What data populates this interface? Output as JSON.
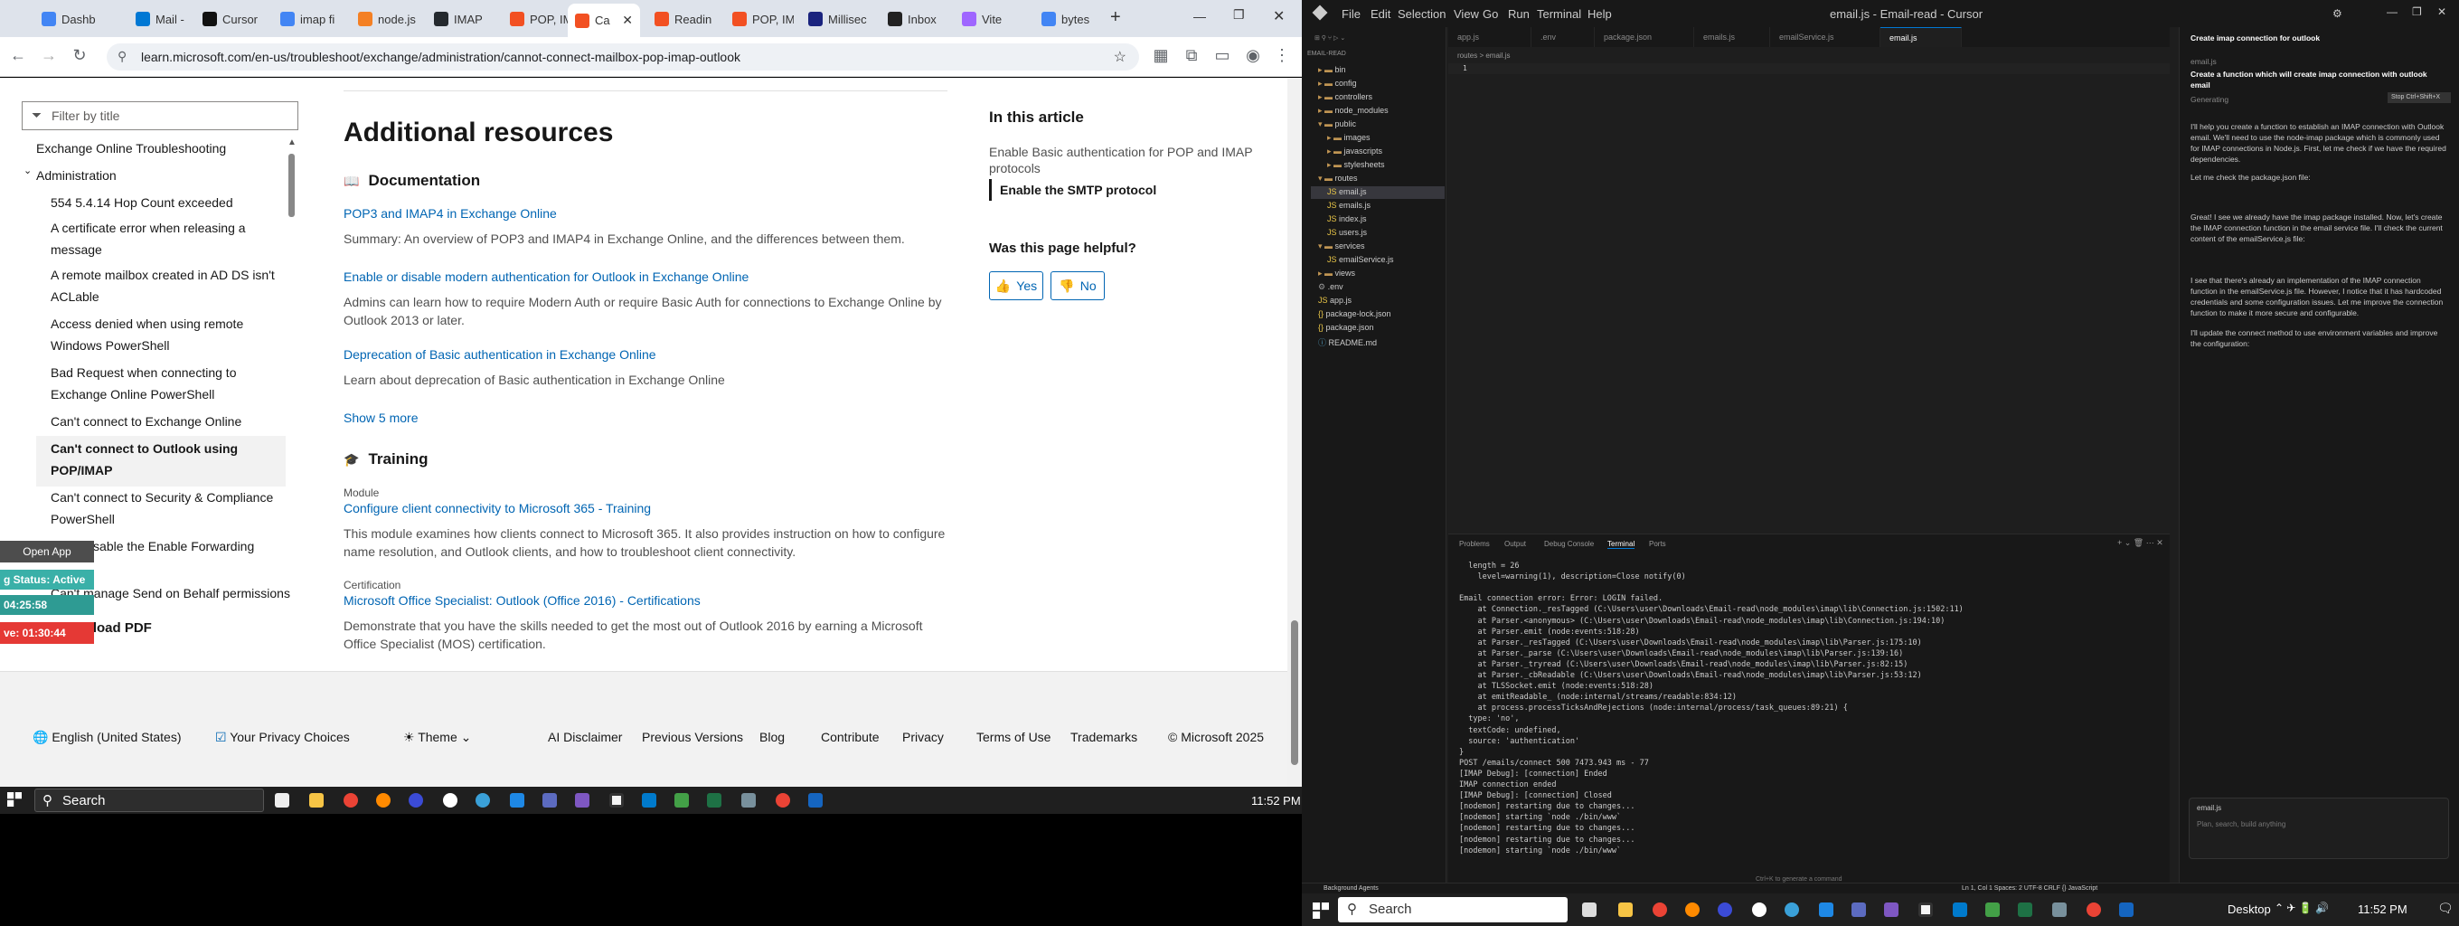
{
  "browser": {
    "tabs": [
      {
        "label": "Dashb",
        "color": "#4285f4"
      },
      {
        "label": "Mail -",
        "color": "#0078d4"
      },
      {
        "label": "Cursor",
        "color": "#111111"
      },
      {
        "label": "imap fi",
        "color": "#4285f4"
      },
      {
        "label": "node.js",
        "color": "#f48024"
      },
      {
        "label": "IMAP",
        "color": "#24292e"
      },
      {
        "label": "POP, IM",
        "color": "#f25022"
      },
      {
        "label": "Ca",
        "color": "#f25022"
      },
      {
        "label": "Readin",
        "color": "#f25022"
      },
      {
        "label": "POP, IM",
        "color": "#f25022"
      },
      {
        "label": "Millisec",
        "color": "#1a237e"
      },
      {
        "label": "Inbox",
        "color": "#222222"
      },
      {
        "label": "Vite",
        "color": "#9f66ff"
      },
      {
        "label": "bytes",
        "color": "#4285f4"
      }
    ],
    "url": "learn.microsoft.com/en-us/troubleshoot/exchange/administration/cannot-connect-mailbox-pop-imap-outlook"
  },
  "sidebar": {
    "filter_placeholder": "Filter by title",
    "items": [
      "Exchange Online Troubleshooting",
      "Administration",
      "554 5.4.14 Hop Count exceeded",
      "A certificate error when releasing a",
      "message",
      "A remote mailbox created in AD DS isn't",
      "ACLable",
      "Access denied when using remote",
      "Windows PowerShell",
      "Bad Request when connecting to",
      "Exchange Online PowerShell",
      "Can't connect to Exchange Online",
      "Can't connect to Outlook using",
      "POP/IMAP",
      "Can't connect to Security & Compliance",
      "PowerShell",
      "Can't disable the Enable Forwarding",
      "Can't manage Send on Behalf permissions"
    ],
    "download_pdf": "Download PDF"
  },
  "overlay": {
    "open_app": "Open App",
    "status": "g Status: Active",
    "time1": "04:25:58",
    "time2": "ve: 01:30:44"
  },
  "main": {
    "heading": "Additional resources",
    "documentation_heading": "Documentation",
    "docs": [
      {
        "title": "POP3 and IMAP4 in Exchange Online",
        "desc": "Summary: An overview of POP3 and IMAP4 in Exchange Online, and the differences between them."
      },
      {
        "title": "Enable or disable modern authentication for Outlook in Exchange Online",
        "desc": "Admins can learn how to require Modern Auth or require Basic Auth for connections to Exchange Online by Outlook 2013 or later."
      },
      {
        "title": "Deprecation of Basic authentication in Exchange Online",
        "desc": "Learn about deprecation of Basic authentication in Exchange Online"
      }
    ],
    "show_more": "Show 5 more",
    "training_heading": "Training",
    "module_label": "Module",
    "module_title": "Configure client connectivity to Microsoft 365 - Training",
    "module_desc": "This module examines how clients connect to Microsoft 365. It also provides instruction on how to configure name resolution, and Outlook clients, and how to troubleshoot client connectivity.",
    "cert_label": "Certification",
    "cert_title": "Microsoft Office Specialist: Outlook (Office 2016) - Certifications",
    "cert_desc": "Demonstrate that you have the skills needed to get the most out of Outlook 2016 by earning a Microsoft Office Specialist (MOS) certification."
  },
  "article_nav": {
    "heading": "In this article",
    "items": [
      "Enable Basic authentication for POP and IMAP",
      "protocols",
      "Enable the SMTP protocol"
    ],
    "helpful": "Was this page helpful?",
    "yes": "Yes",
    "no": "No"
  },
  "footer": {
    "locale": "English (United States)",
    "privacy": "Your Privacy Choices",
    "theme": "Theme",
    "links": [
      "AI Disclaimer",
      "Previous Versions",
      "Blog",
      "Contribute",
      "Privacy",
      "Terms of Use",
      "Trademarks",
      "© Microsoft 2025"
    ]
  },
  "taskbar_left": {
    "search": "Search",
    "time": "11:52 PM"
  },
  "editor": {
    "menu": [
      "File",
      "Edit",
      "Selection",
      "View",
      "Go",
      "Run",
      "Terminal",
      "Help"
    ],
    "title": "email.js - Email-read - Cursor",
    "explorer_title": "EMAIL-READ",
    "files": [
      "bin",
      "config",
      "controllers",
      "node_modules",
      "public",
      "images",
      "javascripts",
      "stylesheets",
      "routes",
      "email.js",
      "emails.js",
      "index.js",
      "users.js",
      "services",
      "emailService.js",
      "views",
      ".env",
      "app.js",
      "package-lock.json",
      "package.json",
      "README.md"
    ],
    "tabs": [
      "app.js",
      ".env",
      "package.json",
      "emails.js",
      "emailService.js",
      "email.js"
    ],
    "breadcrumb": "routes > email.js",
    "line_no": "1",
    "panel_tabs": [
      "Problems",
      "Output",
      "Debug Console",
      "Terminal",
      "Ports"
    ],
    "terminal": [
      "  length = 26",
      "    level=warning(1), description=Close notify(0)",
      "",
      "Email connection error: Error: LOGIN failed.",
      "    at Connection._resTagged (C:\\Users\\user\\Downloads\\Email-read\\node_modules\\imap\\lib\\Connection.js:1502:11)",
      "    at Parser.<anonymous> (C:\\Users\\user\\Downloads\\Email-read\\node_modules\\imap\\lib\\Connection.js:194:10)",
      "    at Parser.emit (node:events:518:28)",
      "    at Parser._resTagged (C:\\Users\\user\\Downloads\\Email-read\\node_modules\\imap\\lib\\Parser.js:175:10)",
      "    at Parser._parse (C:\\Users\\user\\Downloads\\Email-read\\node_modules\\imap\\lib\\Parser.js:139:16)",
      "    at Parser._tryread (C:\\Users\\user\\Downloads\\Email-read\\node_modules\\imap\\lib\\Parser.js:82:15)",
      "    at Parser._cbReadable (C:\\Users\\user\\Downloads\\Email-read\\node_modules\\imap\\lib\\Parser.js:53:12)",
      "    at TLSSocket.emit (node:events:518:28)",
      "    at emitReadable_ (node:internal/streams/readable:834:12)",
      "    at process.processTicksAndRejections (node:internal/process/task_queues:89:21) {",
      "  type: 'no',",
      "  textCode: undefined,",
      "  source: 'authentication'",
      "}",
      "POST /emails/connect 500 7473.943 ms - 77",
      "[IMAP Debug]: [connection] Ended",
      "IMAP connection ended",
      "[IMAP Debug]: [connection] Closed",
      "[nodemon] restarting due to changes...",
      "[nodemon] starting `node ./bin/www`",
      "[nodemon] restarting due to changes...",
      "[nodemon] restarting due to changes...",
      "[nodemon] starting `node ./bin/www`"
    ],
    "terminal_hint": "Ctrl+K to generate a command",
    "chat_title": "Create imap connection for outlook",
    "chat_prompt": "Create a function which will create imap connection with outlook email",
    "chat_generating": "Generating",
    "chat_stop": "Stop Ctrl+Shift+X",
    "chat_messages": [
      "I'll help you create a function to establish an IMAP connection with Outlook email. We'll need to use the node-imap package which is commonly used for IMAP connections in Node.js. First, let me check if we have the required dependencies.",
      "Let me check the package.json file:",
      "Great! I see we already have the imap package installed. Now, let's create the IMAP connection function in the email service file. I'll check the current content of the emailService.js file:",
      "I see that there's already an implementation of the IMAP connection function in the emailService.js file. However, I notice that it has hardcoded credentials and some configuration issues. Let me improve the connection function to make it more secure and configurable.",
      "I'll update the connect method to use environment variables and improve the configuration:"
    ],
    "chat_input_placeholder": "Plan, search, build anything",
    "chat_file": "email.js",
    "status_left": "Background Agents",
    "status_right": "Ln 1, Col 1   Spaces: 2   UTF-8   CRLF   {} JavaScript"
  },
  "taskbar_right": {
    "search": "Search",
    "desktop": "Desktop",
    "time": "11:52 PM"
  }
}
